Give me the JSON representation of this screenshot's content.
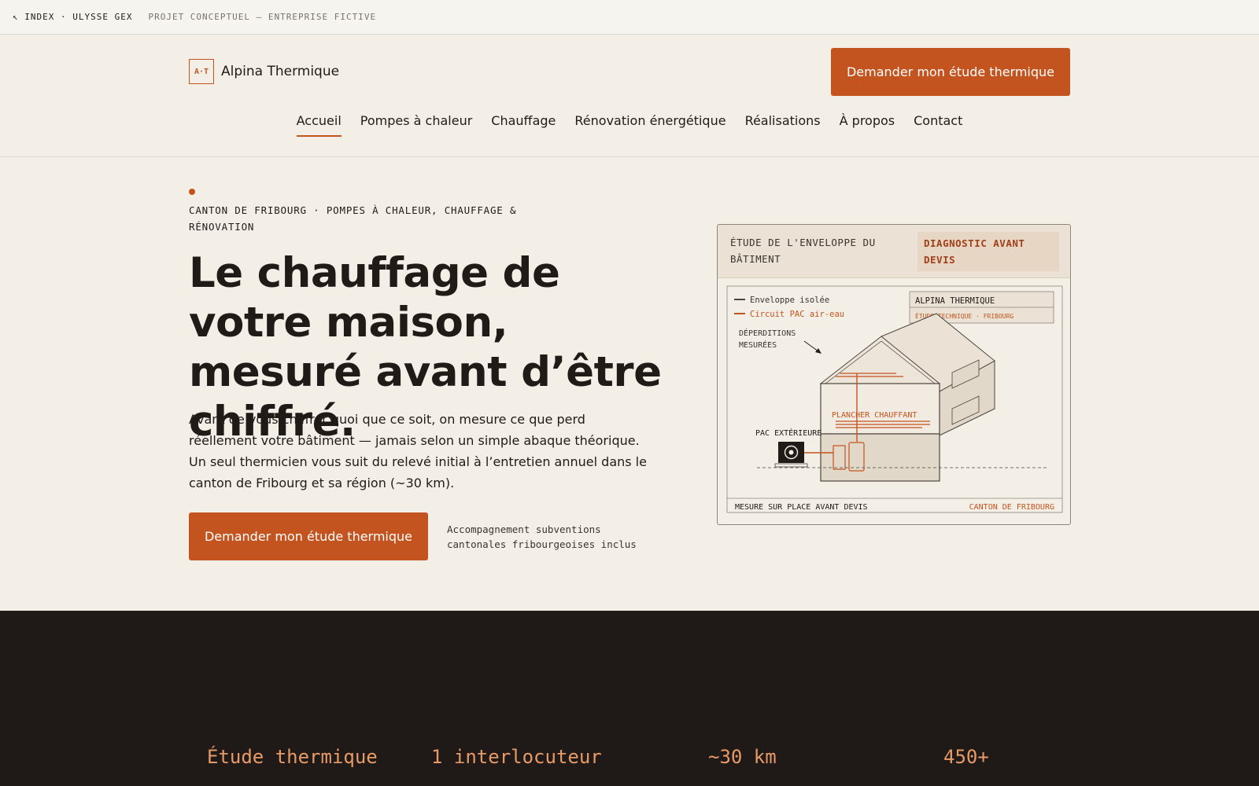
{
  "topbar": {
    "back_label": "↖ INDEX · ULYSSE GEX",
    "project_label": "PROJET CONCEPTUEL — ENTREPRISE FICTIVE"
  },
  "brand": {
    "mark": "A·T",
    "name": "Alpina Thermique"
  },
  "header": {
    "cta_label": "Demander mon étude thermique"
  },
  "nav": {
    "items": [
      {
        "label": "Accueil",
        "active": true
      },
      {
        "label": "Pompes à chaleur"
      },
      {
        "label": "Chauffage"
      },
      {
        "label": "Rénovation énergétique"
      },
      {
        "label": "Réalisations"
      },
      {
        "label": "À propos"
      },
      {
        "label": "Contact"
      }
    ]
  },
  "hero": {
    "eyebrow": "CANTON DE FRIBOURG · POMPES À CHALEUR, CHAUFFAGE & RÉNOVATION",
    "headline": "Le chauffage de votre maison, mesuré avant d’être chiffré.",
    "lead": "Avant de vous chiffrer quoi que ce soit, on mesure ce que perd réellement votre bâtiment — jamais selon un simple abaque théorique. Un seul thermicien vous suit du relevé initial à l’entretien annuel dans le canton de Fribourg et sa région (~30 km).",
    "cta_label": "Demander mon étude thermique",
    "cta_note": "Accompagnement subventions cantonales fribourgeoises inclus"
  },
  "diagram": {
    "title": "ÉTUDE DE L'ENVELOPPE DU BÂTIMENT",
    "badge": "DIAGNOSTIC AVANT DEVIS",
    "legend_insulated": "Enveloppe isolée",
    "legend_circuit": "Circuit PAC air-eau",
    "stamp_title": "ALPINA THERMIQUE",
    "stamp_sub": "ÉTUDE TECHNIQUE · FRIBOURG",
    "loss_line1": "DÉPERDITIONS",
    "loss_line2": "MESURÉES",
    "floor_label": "PLANCHER CHAUFFANT",
    "pac_label": "PAC EXTÉRIEURE",
    "footer_left": "MESURE SUR PLACE AVANT DEVIS",
    "footer_right": "CANTON DE FRIBOURG",
    "colors": {
      "accent": "#c4541f",
      "line": "#4a4540"
    }
  },
  "stats": [
    {
      "label": "Étude thermique"
    },
    {
      "label": "1 interlocuteur"
    },
    {
      "label": "~30 km"
    },
    {
      "label": "450+"
    }
  ]
}
